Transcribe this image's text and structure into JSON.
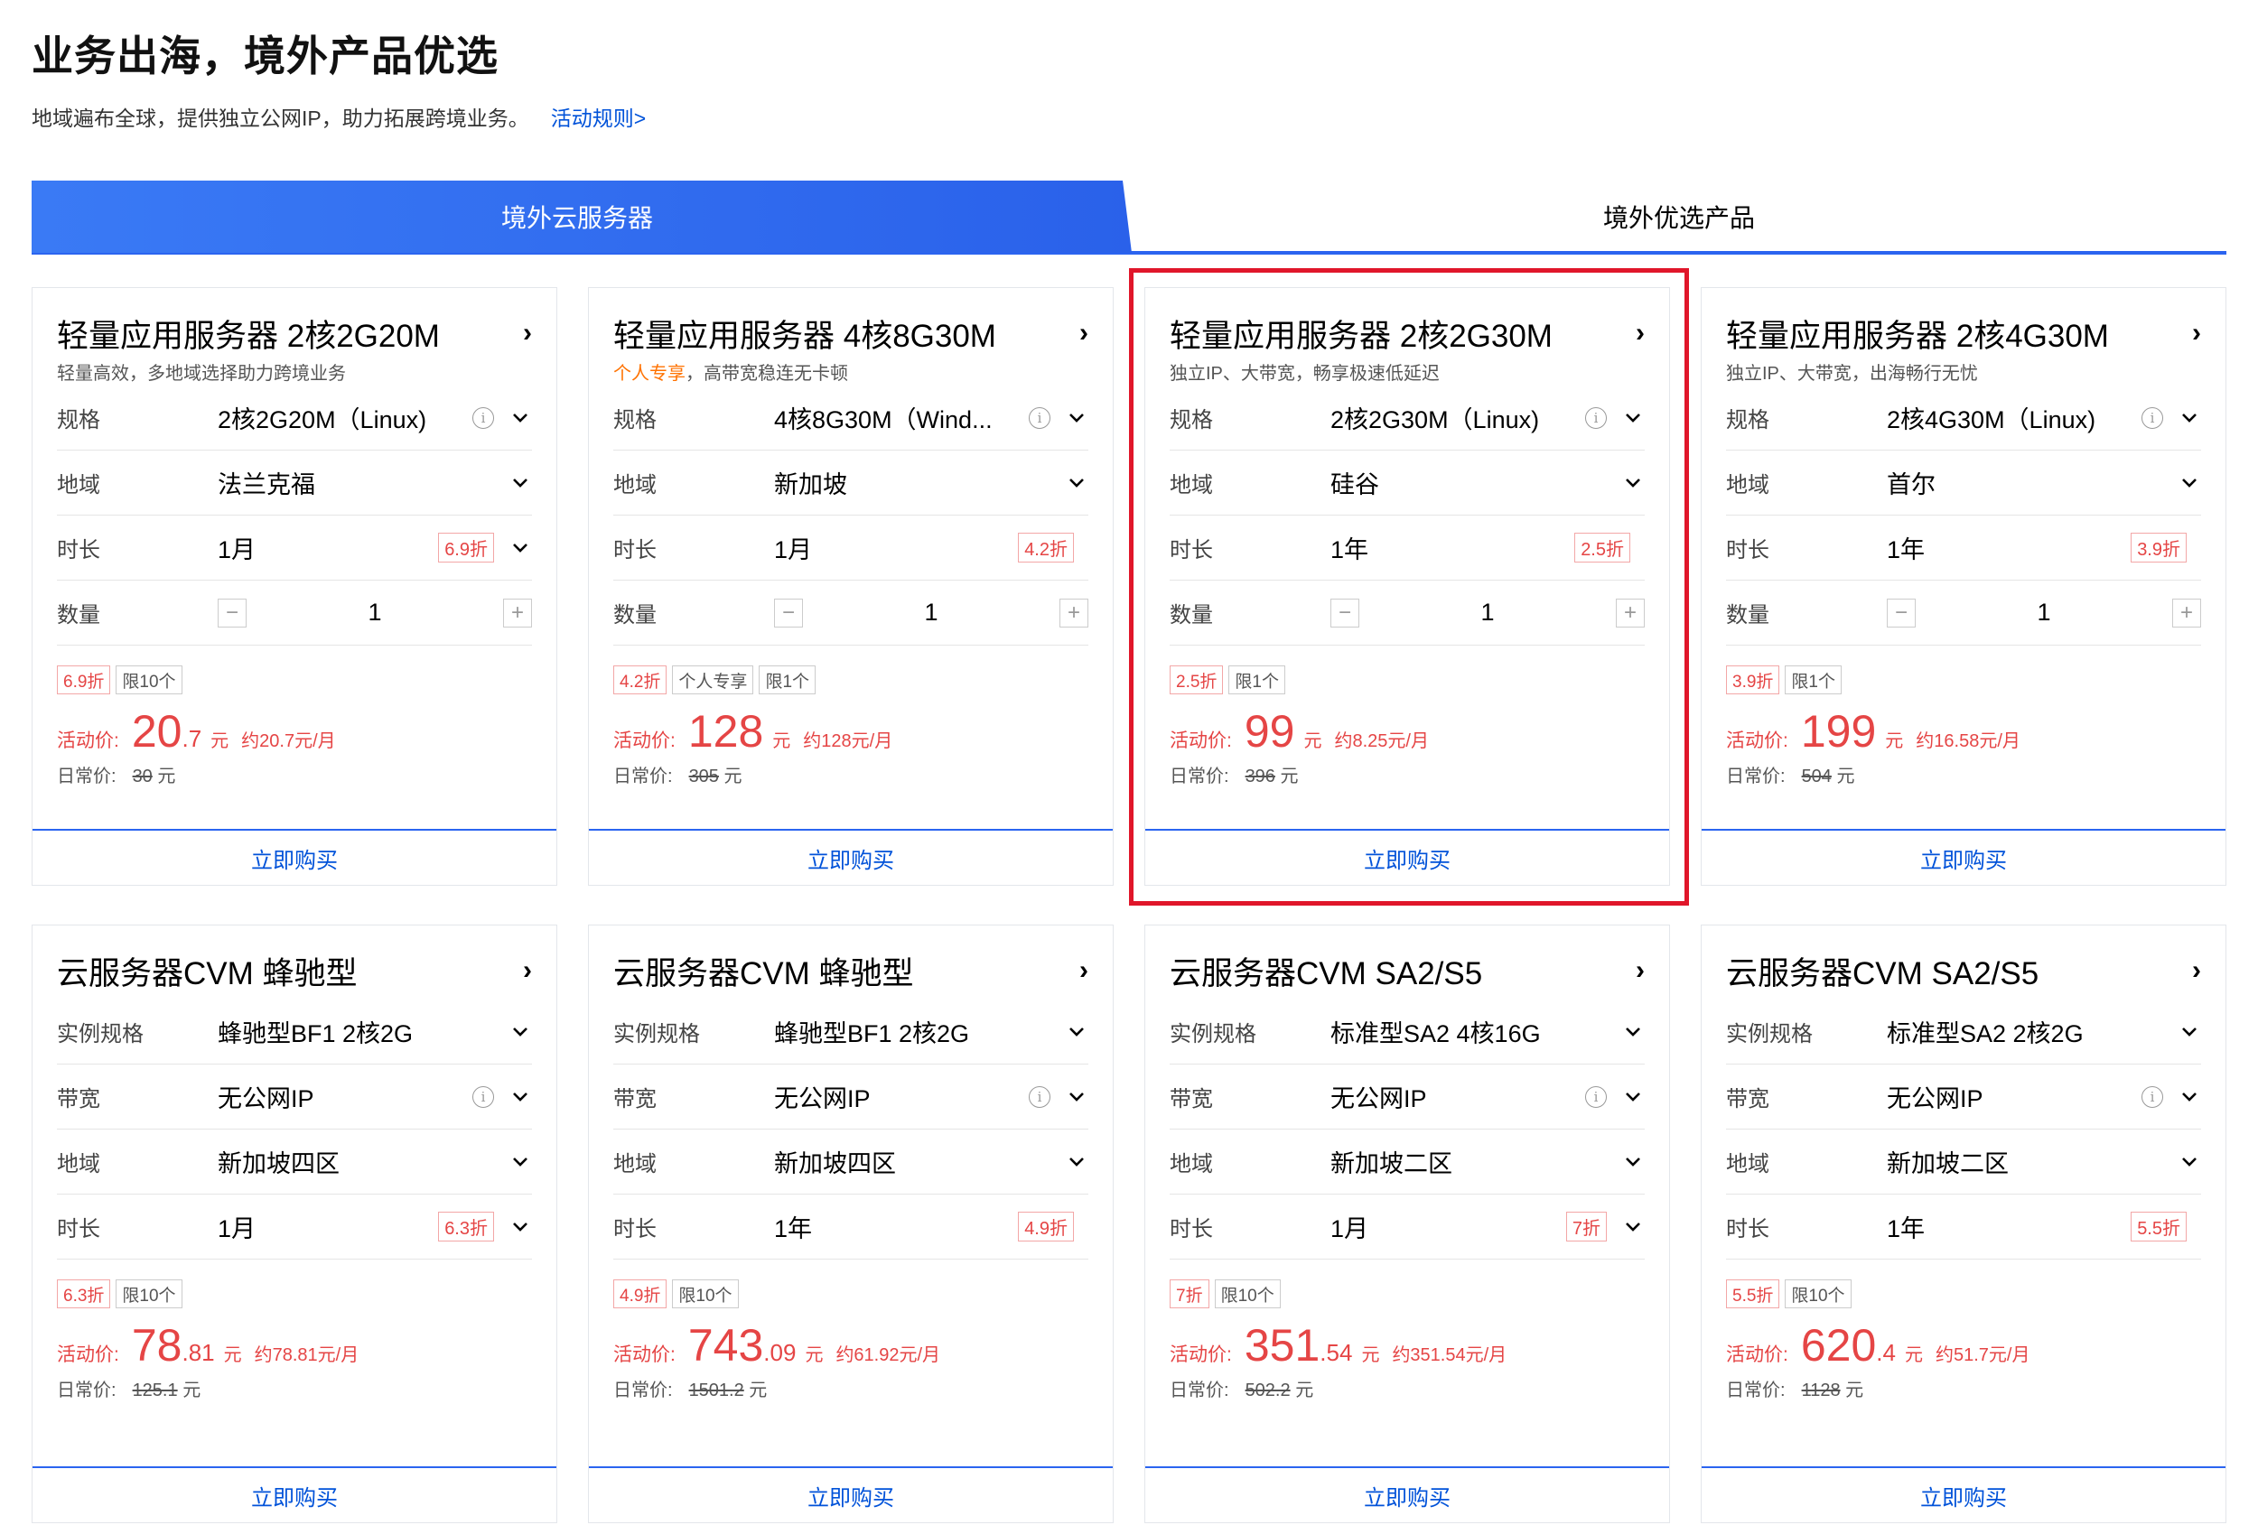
{
  "header": {
    "title": "业务出海，境外产品优选",
    "subtitle": "地域遍布全球，提供独立公网IP，助力拓展跨境业务。",
    "rules_link": "活动规则>"
  },
  "tabs": [
    {
      "label": "境外云服务器",
      "active": true
    },
    {
      "label": "境外优选产品",
      "active": false
    }
  ],
  "colors": {
    "accent": "#2b64f0",
    "price": "#e54545",
    "highlight": "#e0162a",
    "promo": "#ff7200"
  },
  "cards": [
    {
      "title": "轻量应用服务器 2核2G20M",
      "desc_hl": "",
      "desc": "轻量高效，多地域选择助力跨境业务",
      "rows": [
        {
          "label": "规格",
          "value": "2核2G20M（Linux)",
          "info": true,
          "disc": ""
        },
        {
          "label": "地域",
          "value": "法兰克福",
          "info": false,
          "disc": ""
        },
        {
          "label": "时长",
          "value": "1月",
          "info": false,
          "disc": "6.9折",
          "dropdown": true
        }
      ],
      "qty_label": "数量",
      "qty": "1",
      "tags": [
        "6.9折",
        "限10个"
      ],
      "price_label": "活动价:",
      "price_int": "20",
      "price_dec": ".7",
      "unit": "元",
      "monthly": "约20.7元/月",
      "orig_label": "日常价:",
      "orig": "30",
      "orig_unit": "元",
      "buy": "立即购买"
    },
    {
      "title": "轻量应用服务器 4核8G30M",
      "desc_hl": "个人专享",
      "desc": "，高带宽稳连无卡顿",
      "rows": [
        {
          "label": "规格",
          "value": "4核8G30M（Wind...",
          "info": true,
          "disc": ""
        },
        {
          "label": "地域",
          "value": "新加坡",
          "info": false,
          "disc": ""
        },
        {
          "label": "时长",
          "value": "1月",
          "info": false,
          "disc": "4.2折",
          "dropdown": false
        }
      ],
      "qty_label": "数量",
      "qty": "1",
      "tags": [
        "4.2折",
        "个人专享",
        "限1个"
      ],
      "price_label": "活动价:",
      "price_int": "128",
      "price_dec": "",
      "unit": "元",
      "monthly": "约128元/月",
      "orig_label": "日常价:",
      "orig": "305",
      "orig_unit": "元",
      "buy": "立即购买"
    },
    {
      "title": "轻量应用服务器 2核2G30M",
      "desc_hl": "",
      "desc": "独立IP、大带宽，畅享极速低延迟",
      "rows": [
        {
          "label": "规格",
          "value": "2核2G30M（Linux)",
          "info": true,
          "disc": ""
        },
        {
          "label": "地域",
          "value": "硅谷",
          "info": false,
          "disc": ""
        },
        {
          "label": "时长",
          "value": "1年",
          "info": false,
          "disc": "2.5折",
          "dropdown": false
        }
      ],
      "qty_label": "数量",
      "qty": "1",
      "tags": [
        "2.5折",
        "限1个"
      ],
      "price_label": "活动价:",
      "price_int": "99",
      "price_dec": "",
      "unit": "元",
      "monthly": "约8.25元/月",
      "orig_label": "日常价:",
      "orig": "396",
      "orig_unit": "元",
      "buy": "立即购买"
    },
    {
      "title": "轻量应用服务器 2核4G30M",
      "desc_hl": "",
      "desc": "独立IP、大带宽，出海畅行无忧",
      "rows": [
        {
          "label": "规格",
          "value": "2核4G30M（Linux)",
          "info": true,
          "disc": ""
        },
        {
          "label": "地域",
          "value": "首尔",
          "info": false,
          "disc": ""
        },
        {
          "label": "时长",
          "value": "1年",
          "info": false,
          "disc": "3.9折",
          "dropdown": false
        }
      ],
      "qty_label": "数量",
      "qty": "1",
      "tags": [
        "3.9折",
        "限1个"
      ],
      "price_label": "活动价:",
      "price_int": "199",
      "price_dec": "",
      "unit": "元",
      "monthly": "约16.58元/月",
      "orig_label": "日常价:",
      "orig": "504",
      "orig_unit": "元",
      "buy": "立即购买"
    },
    {
      "title": "云服务器CVM 蜂驰型",
      "rows": [
        {
          "label": "实例规格",
          "value": "蜂驰型BF1 2核2G",
          "info": false,
          "disc": ""
        },
        {
          "label": "带宽",
          "value": "无公网IP",
          "info": true,
          "disc": ""
        },
        {
          "label": "地域",
          "value": "新加坡四区",
          "info": false,
          "disc": ""
        },
        {
          "label": "时长",
          "value": "1月",
          "info": false,
          "disc": "6.3折",
          "dropdown": true
        }
      ],
      "tags": [
        "6.3折",
        "限10个"
      ],
      "price_label": "活动价:",
      "price_int": "78",
      "price_dec": ".81",
      "unit": "元",
      "monthly": "约78.81元/月",
      "orig_label": "日常价:",
      "orig": "125.1",
      "orig_unit": "元",
      "buy": "立即购买"
    },
    {
      "title": "云服务器CVM 蜂驰型",
      "rows": [
        {
          "label": "实例规格",
          "value": "蜂驰型BF1 2核2G",
          "info": false,
          "disc": ""
        },
        {
          "label": "带宽",
          "value": "无公网IP",
          "info": true,
          "disc": ""
        },
        {
          "label": "地域",
          "value": "新加坡四区",
          "info": false,
          "disc": ""
        },
        {
          "label": "时长",
          "value": "1年",
          "info": false,
          "disc": "4.9折",
          "dropdown": false
        }
      ],
      "tags": [
        "4.9折",
        "限10个"
      ],
      "price_label": "活动价:",
      "price_int": "743",
      "price_dec": ".09",
      "unit": "元",
      "monthly": "约61.92元/月",
      "orig_label": "日常价:",
      "orig": "1501.2",
      "orig_unit": "元",
      "buy": "立即购买"
    },
    {
      "title": "云服务器CVM SA2/S5",
      "rows": [
        {
          "label": "实例规格",
          "value": "标准型SA2 4核16G",
          "info": false,
          "disc": ""
        },
        {
          "label": "带宽",
          "value": "无公网IP",
          "info": true,
          "disc": ""
        },
        {
          "label": "地域",
          "value": "新加坡二区",
          "info": false,
          "disc": ""
        },
        {
          "label": "时长",
          "value": "1月",
          "info": false,
          "disc": "7折",
          "dropdown": true
        }
      ],
      "tags": [
        "7折",
        "限10个"
      ],
      "price_label": "活动价:",
      "price_int": "351",
      "price_dec": ".54",
      "unit": "元",
      "monthly": "约351.54元/月",
      "orig_label": "日常价:",
      "orig": "502.2",
      "orig_unit": "元",
      "buy": "立即购买"
    },
    {
      "title": "云服务器CVM SA2/S5",
      "rows": [
        {
          "label": "实例规格",
          "value": "标准型SA2 2核2G",
          "info": false,
          "disc": ""
        },
        {
          "label": "带宽",
          "value": "无公网IP",
          "info": true,
          "disc": ""
        },
        {
          "label": "地域",
          "value": "新加坡二区",
          "info": false,
          "disc": ""
        },
        {
          "label": "时长",
          "value": "1年",
          "info": false,
          "disc": "5.5折",
          "dropdown": false
        }
      ],
      "tags": [
        "5.5折",
        "限10个"
      ],
      "price_label": "活动价:",
      "price_int": "620",
      "price_dec": ".4",
      "unit": "元",
      "monthly": "约51.7元/月",
      "orig_label": "日常价:",
      "orig": "1128",
      "orig_unit": "元",
      "buy": "立即购买"
    }
  ]
}
